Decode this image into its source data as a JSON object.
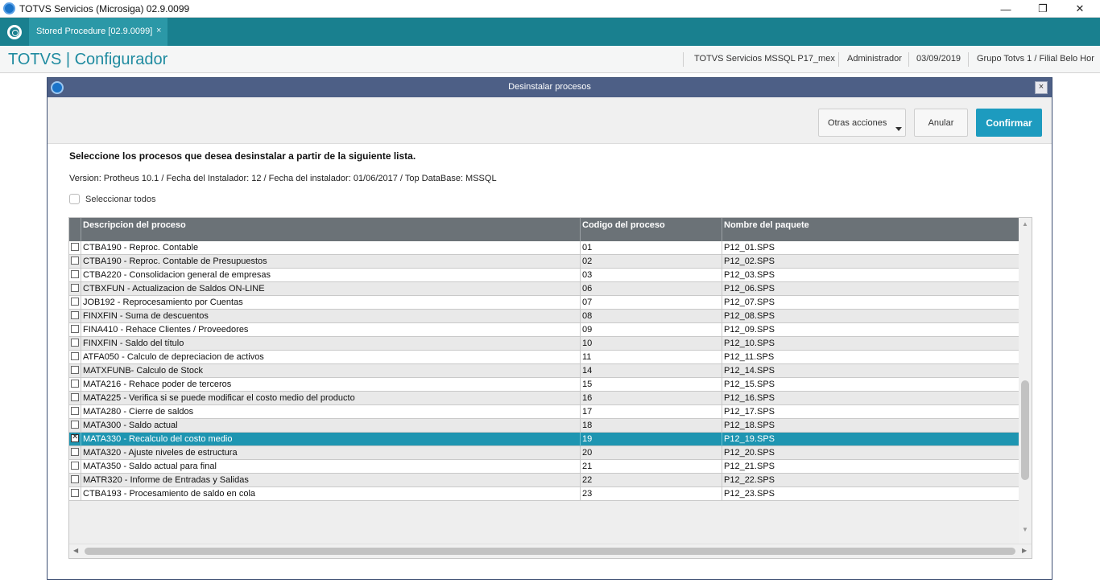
{
  "window": {
    "title": "TOTVS Servicios (Microsiga) 02.9.0099",
    "min": "—",
    "max": "❐",
    "close": "✕"
  },
  "tabs": [
    {
      "label": "Stored Procedure [02.9.0099]",
      "close": "×"
    }
  ],
  "header": {
    "brand": "TOTVS | Configurador",
    "environment": "TOTVS Servicios MSSQL P17_mex",
    "user": "Administrador",
    "date": "03/09/2019",
    "branch": "Grupo Totvs 1 / Filial Belo Hor"
  },
  "dialog": {
    "title": "Desinstalar procesos",
    "close": "×",
    "buttons": {
      "otras": "Otras acciones",
      "anular": "Anular",
      "confirmar": "Confirmar"
    },
    "instruction": "Seleccione los procesos que desea desinstalar a partir de la siguiente lista.",
    "version_line": "Version: Protheus 10.1 / Fecha del Instalador: 12 / Fecha del instalador: 01/06/2017 / Top DataBase: MSSQL",
    "select_all": "Seleccionar todos",
    "columns": [
      "Descripcion del proceso",
      "Codigo del proceso",
      "Nombre del paquete"
    ],
    "rows": [
      {
        "desc": "CTBA190 - Reproc. Contable",
        "code": "01",
        "pkg": "P12_01.SPS",
        "checked": false
      },
      {
        "desc": "CTBA190 - Reproc. Contable de Presupuestos",
        "code": "02",
        "pkg": "P12_02.SPS",
        "checked": false
      },
      {
        "desc": "CTBA220 - Consolidacion general de empresas",
        "code": "03",
        "pkg": "P12_03.SPS",
        "checked": false
      },
      {
        "desc": "CTBXFUN - Actualizacion de Saldos ON-LINE",
        "code": "06",
        "pkg": "P12_06.SPS",
        "checked": false
      },
      {
        "desc": "JOB192 - Reprocesamiento por Cuentas",
        "code": "07",
        "pkg": "P12_07.SPS",
        "checked": false
      },
      {
        "desc": "FINXFIN - Suma de descuentos",
        "code": "08",
        "pkg": "P12_08.SPS",
        "checked": false
      },
      {
        "desc": "FINA410 - Rehace Clientes / Proveedores",
        "code": "09",
        "pkg": "P12_09.SPS",
        "checked": false
      },
      {
        "desc": "FINXFIN - Saldo del título",
        "code": "10",
        "pkg": "P12_10.SPS",
        "checked": false
      },
      {
        "desc": "ATFA050 - Calculo de depreciacion de activos",
        "code": "11",
        "pkg": "P12_11.SPS",
        "checked": false
      },
      {
        "desc": "MATXFUNB- Calculo de Stock",
        "code": "14",
        "pkg": "P12_14.SPS",
        "checked": false
      },
      {
        "desc": "MATA216 - Rehace poder de terceros",
        "code": "15",
        "pkg": "P12_15.SPS",
        "checked": false
      },
      {
        "desc": "MATA225 - Verifica si se puede modificar el costo medio del producto",
        "code": "16",
        "pkg": "P12_16.SPS",
        "checked": false
      },
      {
        "desc": "MATA280 - Cierre de saldos",
        "code": "17",
        "pkg": "P12_17.SPS",
        "checked": false
      },
      {
        "desc": "MATA300 - Saldo actual",
        "code": "18",
        "pkg": "P12_18.SPS",
        "checked": false
      },
      {
        "desc": "MATA330 - Recalculo del costo medio",
        "code": "19",
        "pkg": "P12_19.SPS",
        "checked": true,
        "selected": true
      },
      {
        "desc": "MATA320 - Ajuste niveles de estructura",
        "code": "20",
        "pkg": "P12_20.SPS",
        "checked": false
      },
      {
        "desc": "MATA350 - Saldo actual para final",
        "code": "21",
        "pkg": "P12_21.SPS",
        "checked": false
      },
      {
        "desc": "MATR320 - Informe de Entradas y Salidas",
        "code": "22",
        "pkg": "P12_22.SPS",
        "checked": false
      },
      {
        "desc": "CTBA193 - Procesamiento de saldo en cola",
        "code": "23",
        "pkg": "P12_23.SPS",
        "checked": false
      }
    ]
  },
  "colors": {
    "accent": "#19808f",
    "confirm": "#1d9bbf",
    "selected_row": "#1e95b1",
    "dialog_title": "#4d5f86",
    "grid_header": "#6b7277"
  },
  "icons": {
    "scroll_up": "▲",
    "scroll_down": "▼",
    "scroll_left": "◀",
    "scroll_right": "▶"
  }
}
